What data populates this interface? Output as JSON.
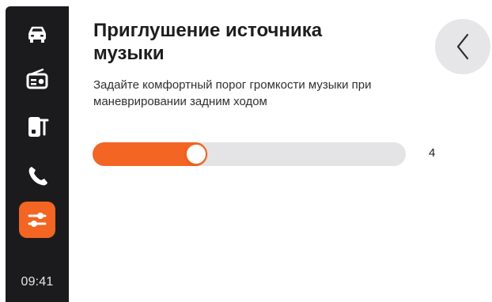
{
  "sidebar": {
    "icons": [
      {
        "name": "car-icon",
        "active": false
      },
      {
        "name": "radio-icon",
        "active": false
      },
      {
        "name": "phone-connect-icon",
        "active": false
      },
      {
        "name": "call-icon",
        "active": false
      },
      {
        "name": "settings-sliders-icon",
        "active": true
      }
    ],
    "time": "09:41"
  },
  "header": {
    "title": "Приглушение источника музыки",
    "subtitle": "Задайте комфортный порог громкости музыки при маневрировании задним ходом"
  },
  "back_button": {
    "icon": "chevron-left-icon"
  },
  "slider": {
    "value": "4",
    "level": 0.33
  },
  "colors": {
    "accent": "#f26522",
    "sidebar": "#1b1b1d",
    "track": "#e4e4e6",
    "back_button": "#e6e6e8"
  }
}
